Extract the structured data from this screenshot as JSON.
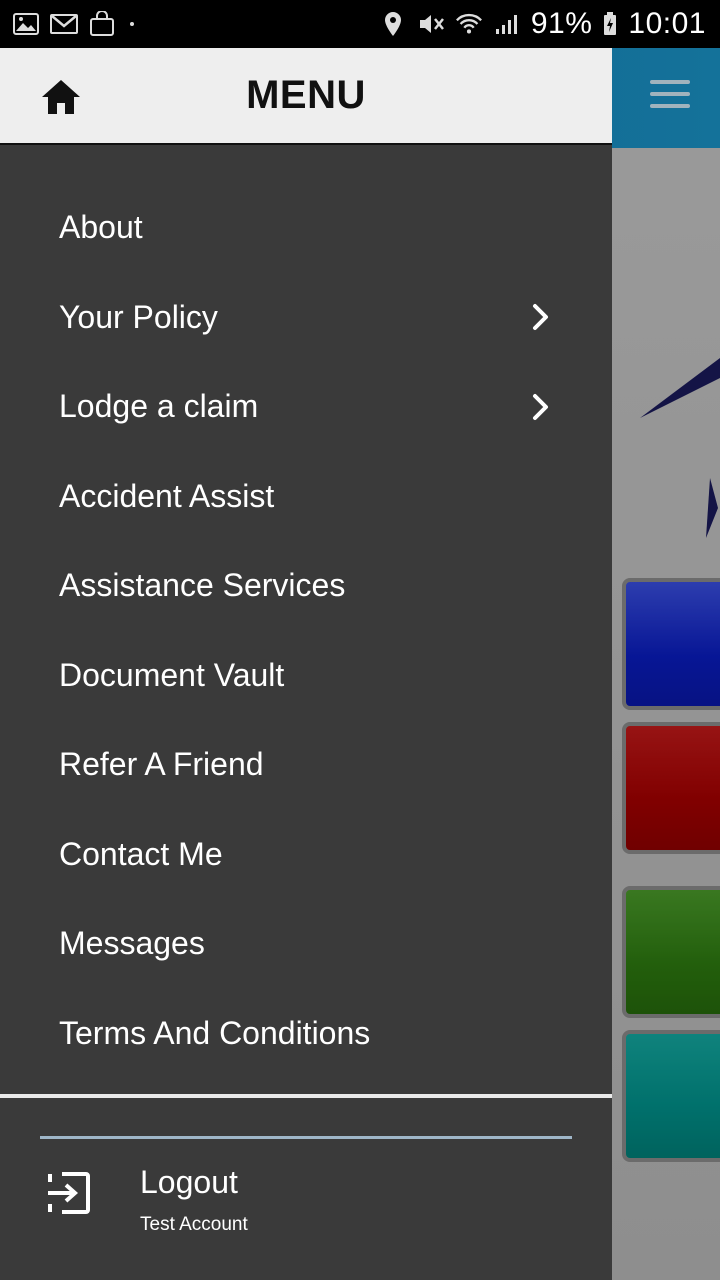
{
  "status_bar": {
    "battery": "91%",
    "time": "10:01",
    "left_icons": [
      "image-icon",
      "gmail-icon",
      "shopping-bag-icon"
    ],
    "right_icons": [
      "location-icon",
      "vibrate-mute-icon",
      "wifi-icon",
      "signal-icon",
      "battery-icon"
    ]
  },
  "drawer": {
    "title": "MENU",
    "items": [
      {
        "label": "About",
        "has_chevron": false
      },
      {
        "label": "Your Policy",
        "has_chevron": true
      },
      {
        "label": "Lodge a claim",
        "has_chevron": true
      },
      {
        "label": "Accident Assist",
        "has_chevron": false
      },
      {
        "label": "Assistance Services",
        "has_chevron": false
      },
      {
        "label": "Document Vault",
        "has_chevron": false
      },
      {
        "label": "Refer A Friend",
        "has_chevron": false
      },
      {
        "label": "Contact Me",
        "has_chevron": false
      },
      {
        "label": "Messages",
        "has_chevron": false
      },
      {
        "label": "Terms And Conditions",
        "has_chevron": false
      }
    ],
    "footer": {
      "logout_label": "Logout",
      "account_label": "Test Account"
    }
  },
  "background_app": {
    "topbar_color": "#1a92c6",
    "tile_colors": [
      "#0a1dc0",
      "#a50000",
      "#2d7a10",
      "#00908a"
    ]
  }
}
